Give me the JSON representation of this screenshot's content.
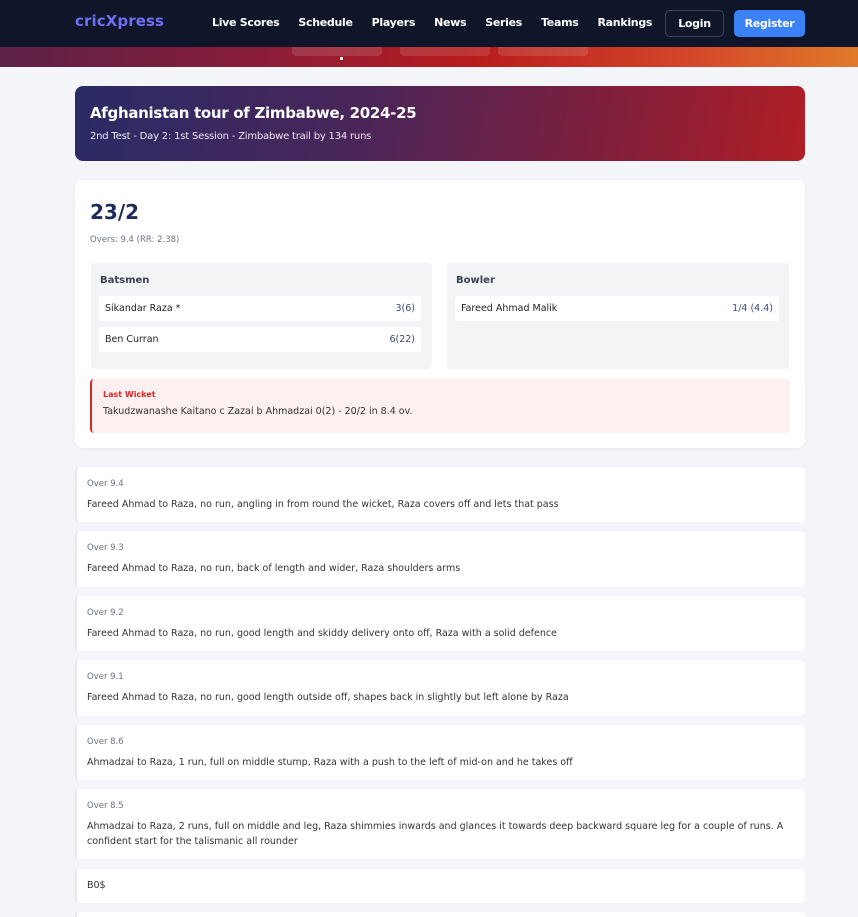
{
  "nav": {
    "brand": "cricXpress",
    "links": [
      "Live Scores",
      "Schedule",
      "Players",
      "News",
      "Series",
      "Teams",
      "Rankings"
    ],
    "login": "Login",
    "register": "Register"
  },
  "match": {
    "title": "Afghanistan tour of Zimbabwe, 2024-25",
    "status": "2nd Test - Day 2: 1st Session - Zimbabwe trail by 134 runs"
  },
  "score": {
    "total": "23/2",
    "overs": "Overs: 9.4 (RR: 2.38)",
    "batsmen_title": "Batsmen",
    "bowler_title": "Bowler",
    "batsmen": [
      {
        "name": "Sikandar Raza *",
        "score": "3(6)"
      },
      {
        "name": "Ben Curran",
        "score": "6(22)"
      }
    ],
    "bowler": {
      "name": "Fareed Ahmad Malik",
      "figures": "1/4 (4.4)"
    },
    "last_wicket_label": "Last Wicket",
    "last_wicket": "Takudzwanashe Kaitano c Zazai b Ahmadzai 0(2) - 20/2 in 8.4 ov."
  },
  "commentary": [
    {
      "over": "Over 9.4",
      "text": "Fareed Ahmad to Raza, no run, angling in from round the wicket, Raza covers off and lets that pass"
    },
    {
      "over": "Over 9.3",
      "text": "Fareed Ahmad to Raza, no run, back of length and wider, Raza shoulders arms"
    },
    {
      "over": "Over 9.2",
      "text": "Fareed Ahmad to Raza, no run, good length and skiddy delivery onto off, Raza with a solid defence"
    },
    {
      "over": "Over 9.1",
      "text": "Fareed Ahmad to Raza, no run, good length outside off, shapes back in slightly but left alone by Raza"
    },
    {
      "over": "Over 8.6",
      "text": "Ahmadzai to Raza, 1 run, full on middle stump, Raza with a push to the left of mid-on and he takes off"
    },
    {
      "over": "Over 8.5",
      "text": "Ahmadzai to Raza, 2 runs, full on middle and leg, Raza shimmies inwards and glances it towards deep backward square leg for a couple of runs. A confident start for the talismanic all rounder"
    }
  ],
  "misc_row": "B0$"
}
